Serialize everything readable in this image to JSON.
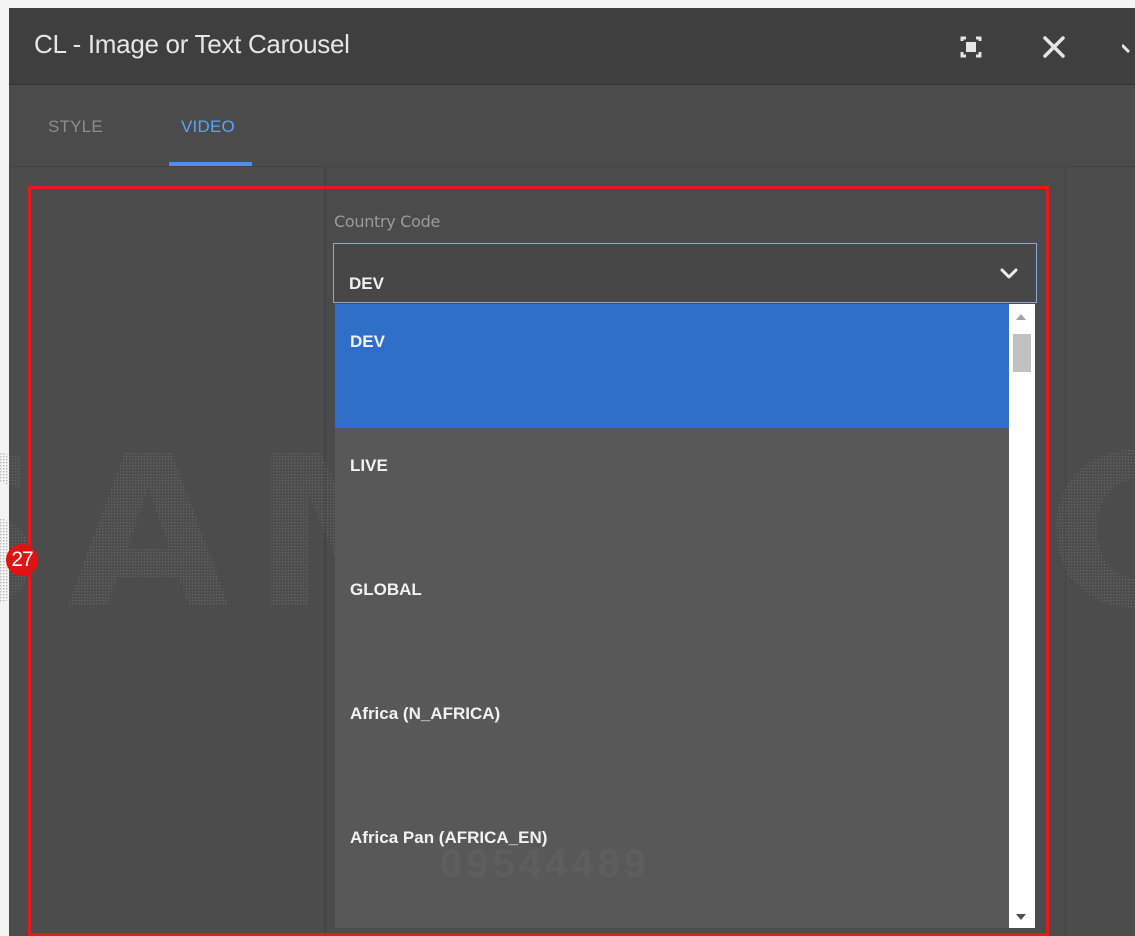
{
  "dialog": {
    "title": "CL - Image or Text Carousel",
    "icons": {
      "fullscreen": "fullscreen-icon",
      "close": "close-icon",
      "more": "chevron-down-icon"
    }
  },
  "tabs": [
    {
      "label": "STYLE",
      "active": false
    },
    {
      "label": "VIDEO",
      "active": true
    }
  ],
  "field": {
    "label": "Country Code",
    "selected_value": "DEV",
    "options": [
      "DEV",
      "LIVE",
      "GLOBAL",
      "Africa (N_AFRICA)",
      "Africa Pan (AFRICA_EN)"
    ]
  },
  "annotation": {
    "marker_number": "27",
    "color": "#e81919"
  },
  "watermark": {
    "brand": "SAMSUNG",
    "code": "09544489"
  },
  "colors": {
    "accent": "#4e8df0",
    "selected_option": "#2f6fca",
    "highlight": "#e81919"
  }
}
